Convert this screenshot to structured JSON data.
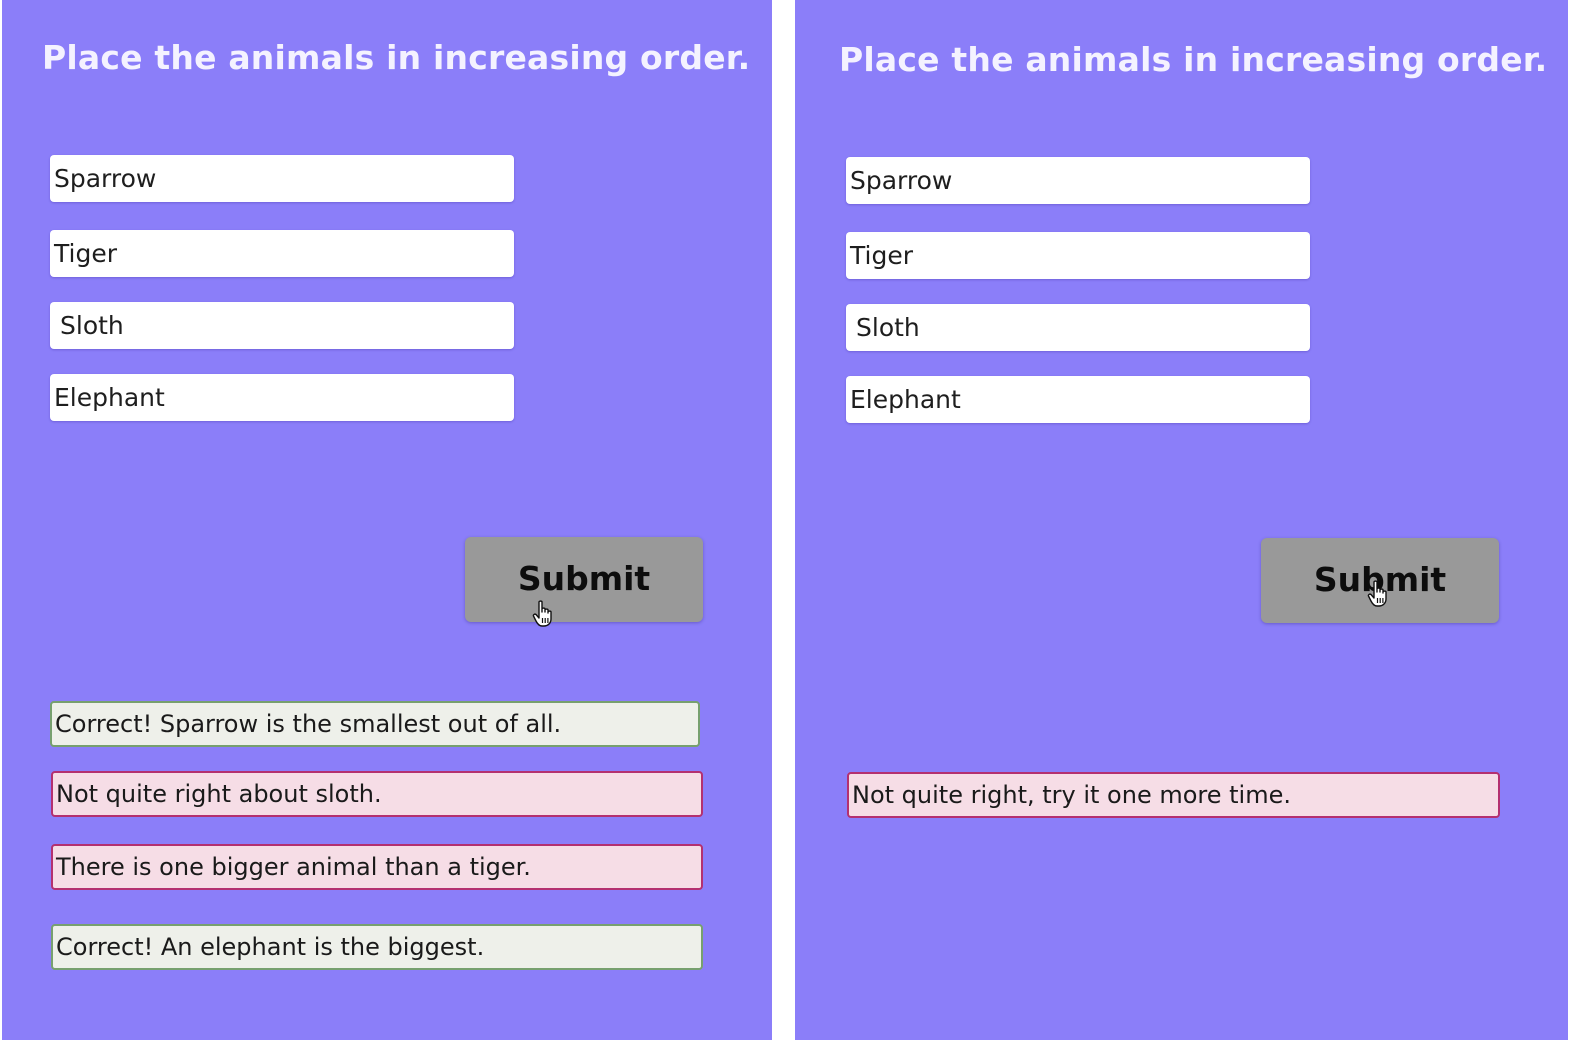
{
  "left": {
    "title": "Place the animals in increasing order.",
    "fields": [
      "Sparrow",
      "Tiger",
      "Sloth",
      "Elephant"
    ],
    "submit_label": "Submit",
    "feedback": [
      {
        "text": "Correct! Sparrow is the smallest out of all.",
        "status": "correct"
      },
      {
        "text": "Not quite right about sloth.",
        "status": "incorrect"
      },
      {
        "text": "There is one bigger animal than a tiger.",
        "status": "incorrect"
      },
      {
        "text": "Correct! An elephant is the biggest.",
        "status": "correct"
      }
    ]
  },
  "right": {
    "title": "Place the animals in increasing order.",
    "fields": [
      "Sparrow",
      "Tiger",
      "Sloth",
      "Elephant"
    ],
    "submit_label": "Submit",
    "feedback": [
      {
        "text": "Not quite right, try it one more time.",
        "status": "incorrect"
      }
    ]
  },
  "colors": {
    "background": "#8b7ef9",
    "button": "#999999",
    "correct_fill": "#eef0ea",
    "correct_border": "#77a06f",
    "incorrect_fill": "#f6dde6",
    "incorrect_border": "#b43070"
  },
  "icons": {
    "cursor": "hand-pointer-icon"
  }
}
